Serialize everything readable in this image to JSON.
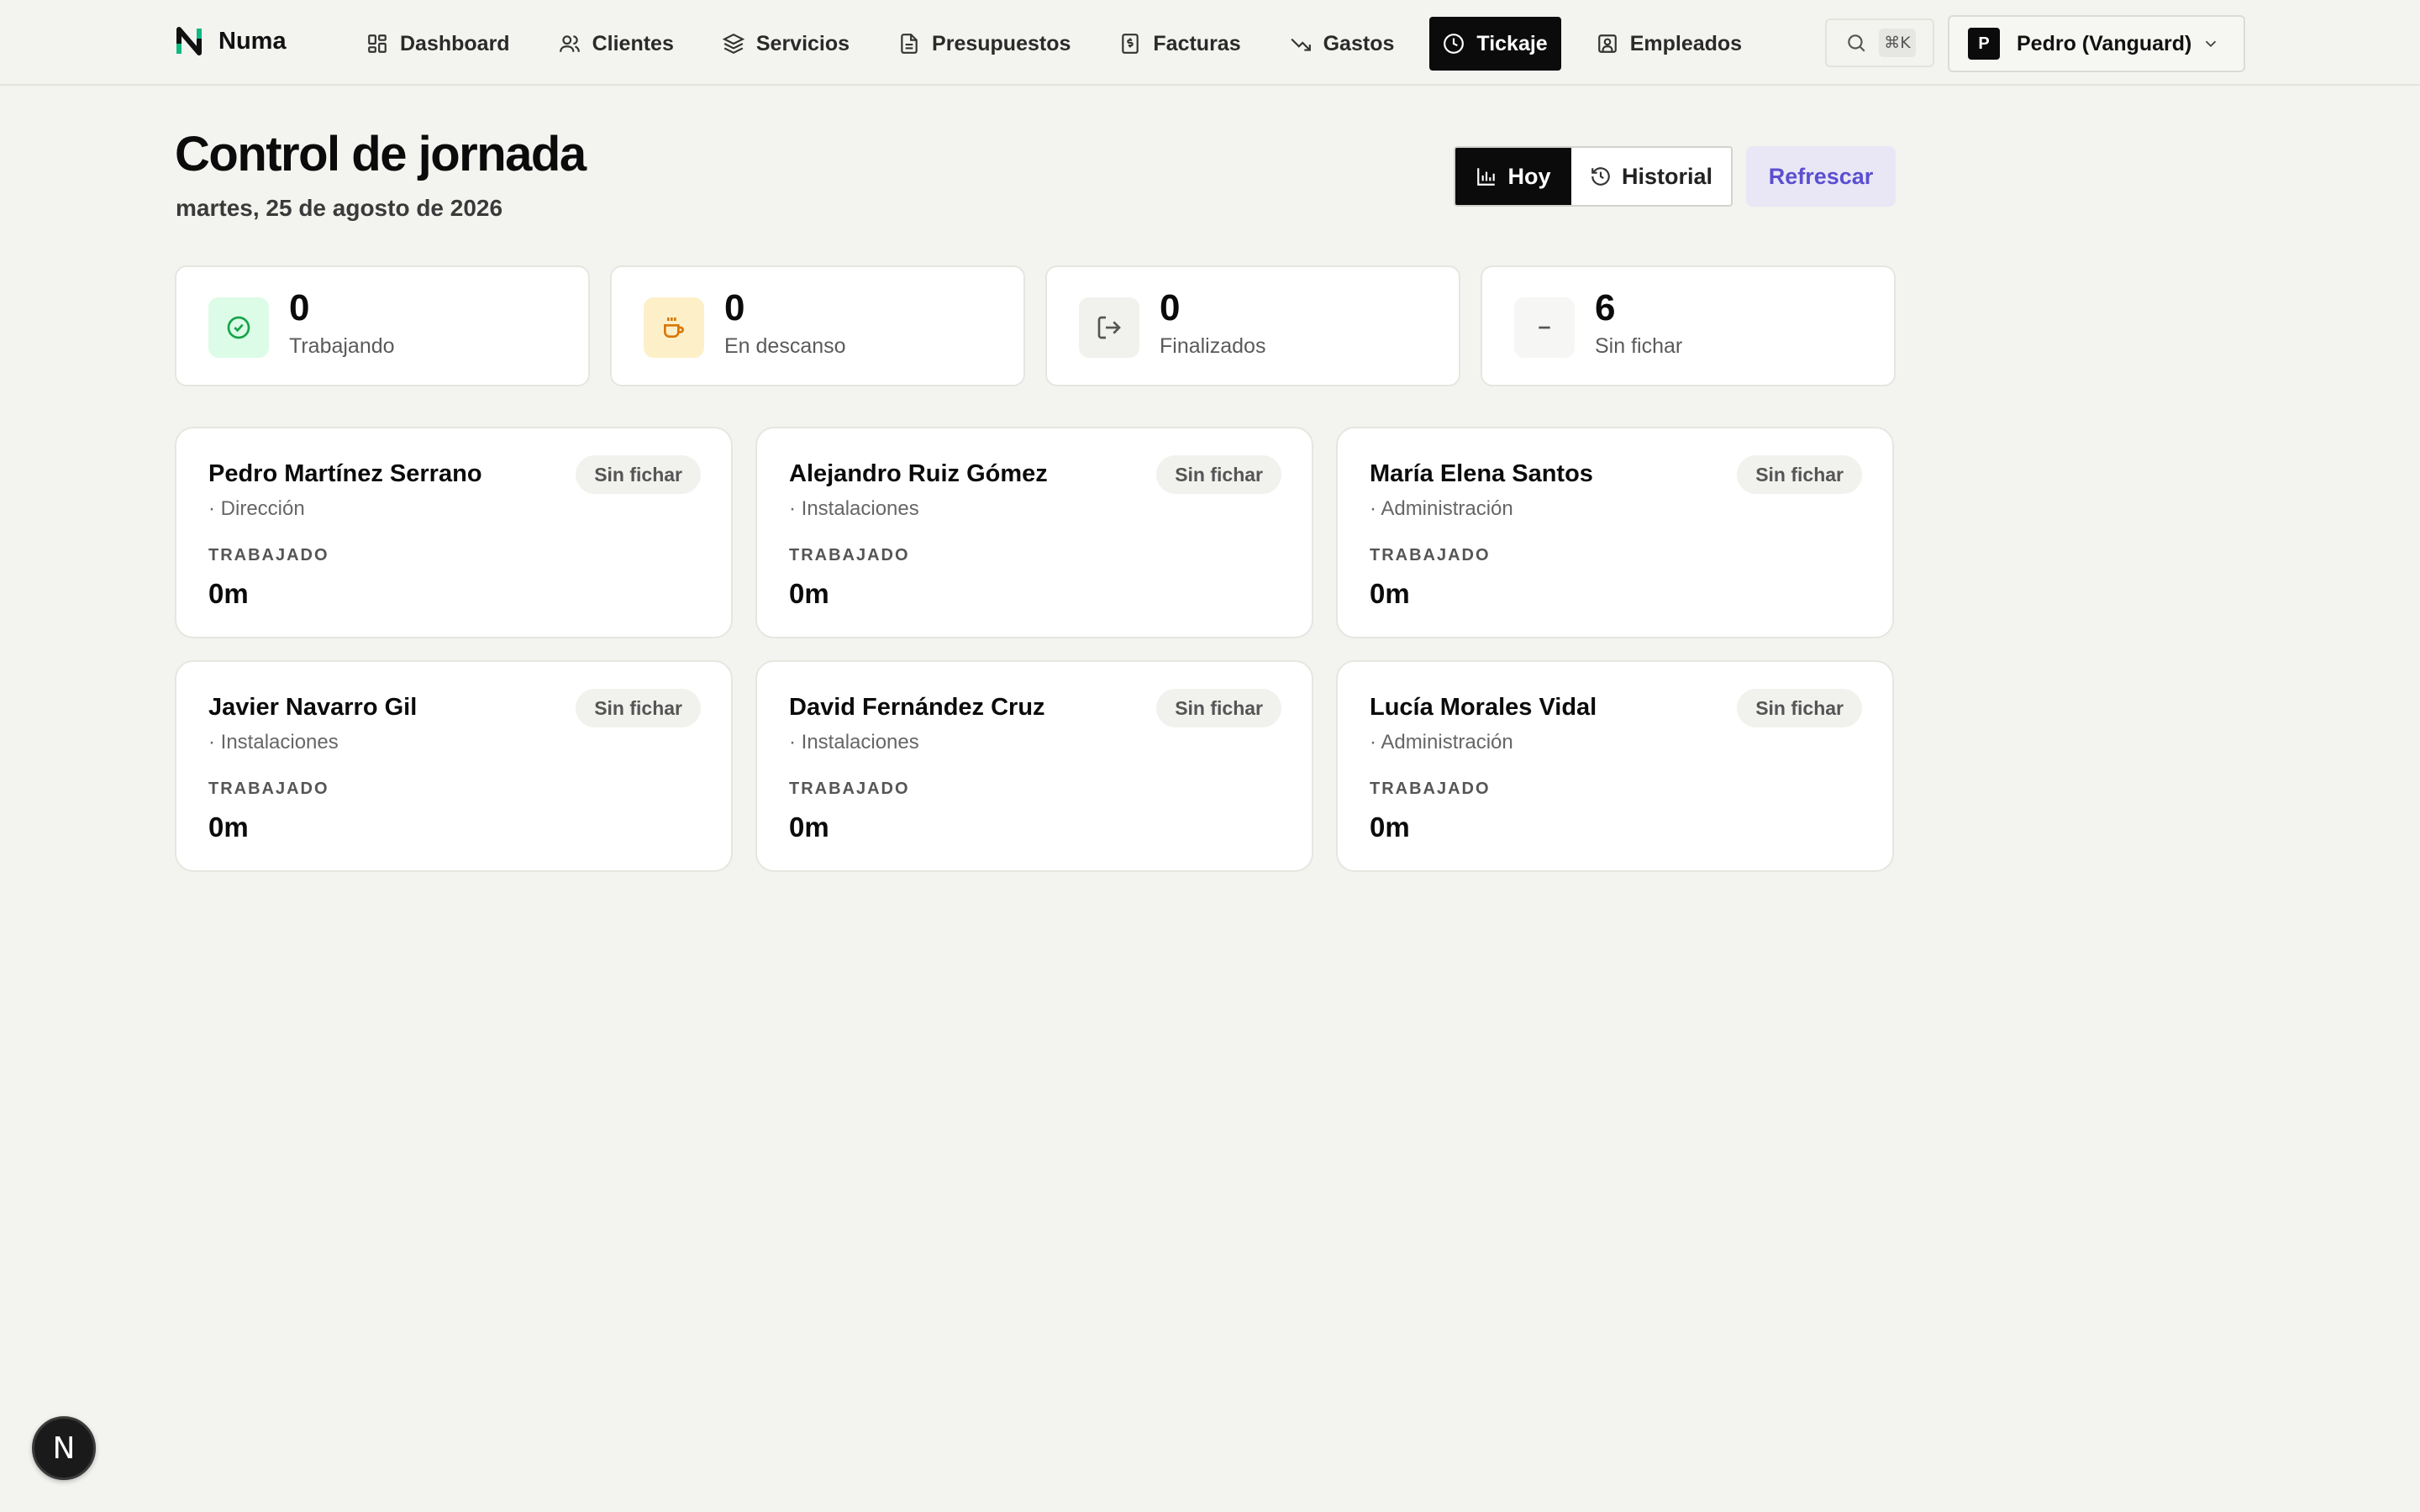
{
  "brand": {
    "name": "Numa",
    "icon": "numa-logo-icon",
    "accent": "#10b981"
  },
  "nav": {
    "items": [
      {
        "label": "Dashboard",
        "icon": "grid-icon",
        "active": false
      },
      {
        "label": "Clientes",
        "icon": "users-icon",
        "active": false
      },
      {
        "label": "Servicios",
        "icon": "layers-icon",
        "active": false
      },
      {
        "label": "Presupuestos",
        "icon": "document-icon",
        "active": false
      },
      {
        "label": "Facturas",
        "icon": "invoice-icon",
        "active": false
      },
      {
        "label": "Gastos",
        "icon": "trending-down-icon",
        "active": false
      },
      {
        "label": "Tickaje",
        "icon": "clock-icon",
        "active": true
      },
      {
        "label": "Empleados",
        "icon": "id-badge-icon",
        "active": false
      }
    ]
  },
  "search": {
    "shortcut": "⌘K",
    "icon": "search-icon"
  },
  "account": {
    "initial": "P",
    "name": "Pedro (Vanguard)"
  },
  "header": {
    "title": "Control de jornada",
    "date": "martes, 25 de agosto de 2026",
    "toggle": {
      "today": "Hoy",
      "history": "Historial"
    },
    "refresh": "Refrescar"
  },
  "stats": [
    {
      "value": "0",
      "label": "Trabajando",
      "icon": "check-circle-icon",
      "color": "#16a34a",
      "bg": "#dcfce7"
    },
    {
      "value": "0",
      "label": "En descanso",
      "icon": "coffee-icon",
      "color": "#d97706",
      "bg": "#fdf0c8"
    },
    {
      "value": "0",
      "label": "Finalizados",
      "icon": "log-out-icon",
      "color": "#555555",
      "bg": "#f1f1ee"
    },
    {
      "value": "6",
      "label": "Sin fichar",
      "icon": "minus-icon",
      "color": "#555555",
      "bg": "#f6f6f4"
    }
  ],
  "employees": [
    {
      "name": "Pedro Martínez Serrano",
      "dept": "· Dirección",
      "status": "Sin fichar",
      "metric_label": "TRABAJADO",
      "worked": "0m"
    },
    {
      "name": "Alejandro Ruiz Gómez",
      "dept": "· Instalaciones",
      "status": "Sin fichar",
      "metric_label": "TRABAJADO",
      "worked": "0m"
    },
    {
      "name": "María Elena Santos",
      "dept": "· Administración",
      "status": "Sin fichar",
      "metric_label": "TRABAJADO",
      "worked": "0m"
    },
    {
      "name": "Javier Navarro Gil",
      "dept": "· Instalaciones",
      "status": "Sin fichar",
      "metric_label": "TRABAJADO",
      "worked": "0m"
    },
    {
      "name": "David Fernández Cruz",
      "dept": "· Instalaciones",
      "status": "Sin fichar",
      "metric_label": "TRABAJADO",
      "worked": "0m"
    },
    {
      "name": "Lucía Morales Vidal",
      "dept": "· Administración",
      "status": "Sin fichar",
      "metric_label": "TRABAJADO",
      "worked": "0m"
    }
  ],
  "dev_badge": {
    "letter": "N"
  }
}
